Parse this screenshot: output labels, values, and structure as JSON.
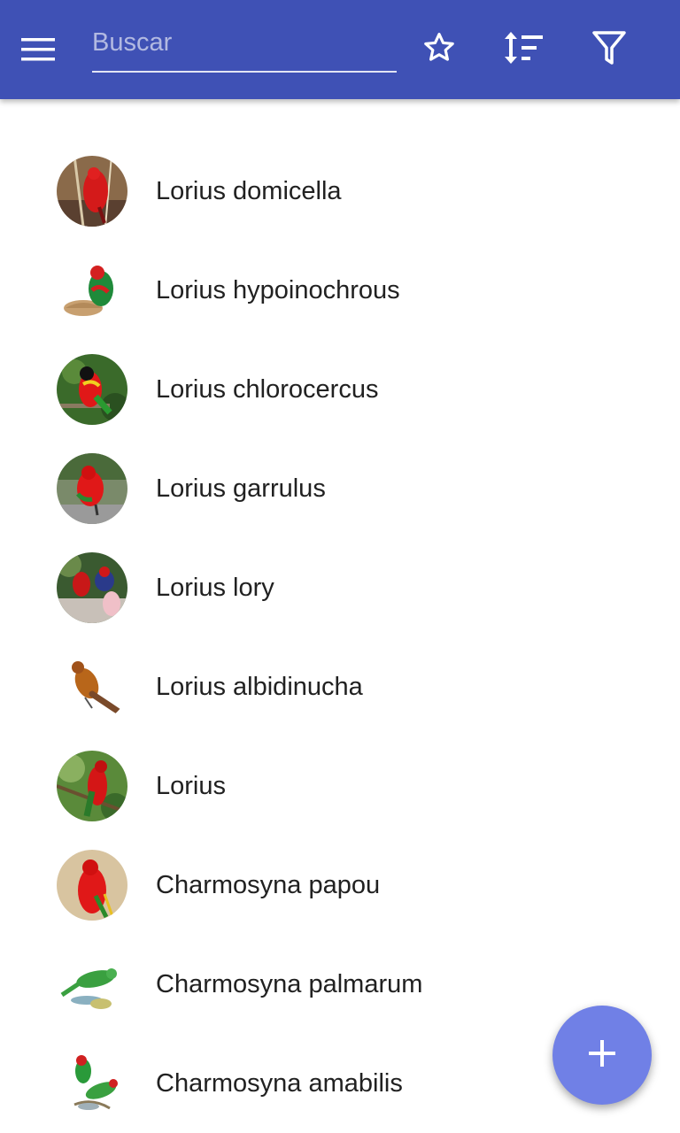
{
  "toolbar": {
    "search_placeholder": "Buscar",
    "icons": {
      "menu": "menu-icon",
      "favorites": "star-outline-icon",
      "sort": "sort-icon",
      "filter": "filter-icon"
    },
    "background_color": "#3f51b5"
  },
  "species": [
    {
      "name": "Lorius domicella",
      "thumb": "bird-thumbnail"
    },
    {
      "name": "Lorius hypoinochrous",
      "thumb": "bird-thumbnail"
    },
    {
      "name": "Lorius chlorocercus",
      "thumb": "bird-thumbnail"
    },
    {
      "name": "Lorius garrulus",
      "thumb": "bird-thumbnail"
    },
    {
      "name": "Lorius lory",
      "thumb": "bird-thumbnail"
    },
    {
      "name": "Lorius albidinucha",
      "thumb": "bird-thumbnail"
    },
    {
      "name": "Lorius",
      "thumb": "bird-thumbnail"
    },
    {
      "name": "Charmosyna papou",
      "thumb": "bird-thumbnail"
    },
    {
      "name": "Charmosyna palmarum",
      "thumb": "bird-thumbnail"
    },
    {
      "name": "Charmosyna amabilis",
      "thumb": "bird-thumbnail"
    }
  ],
  "fab": {
    "icon": "plus-icon",
    "color": "#7080e6"
  }
}
